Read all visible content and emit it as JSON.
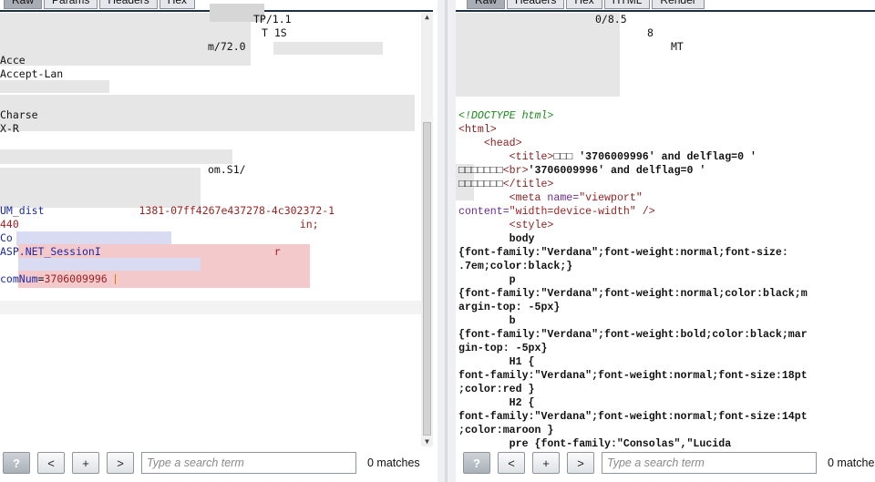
{
  "request": {
    "tabs": [
      "Raw",
      "Params",
      "Headers",
      "Hex"
    ],
    "active_tab": "Raw",
    "lines": {
      "l1_tail": "TP/1.1",
      "l2_tail": "T 1S",
      "l3_tail": "m/72.0",
      "accept": "Acce",
      "accept_lang": "Accept-Lan",
      "charset": "Charse",
      "x": "X-R",
      "ua_tail": "om.S1/",
      "um_key": "UM_dist",
      "um_val": "1381-07ff4267e437278-4c302372-1",
      "l_440": "440",
      "l_440_tail": "in;",
      "co": "Co",
      "aspnet": "ASP.NET_SessionI",
      "aspnet_tail": "r",
      "comnum_key": "comNum",
      "comnum_eq": "=",
      "comnum_val": "3706009996"
    }
  },
  "response": {
    "tabs": [
      "Raw",
      "Headers",
      "Hex",
      "HTML",
      "Render"
    ],
    "active_tab": "Raw",
    "head_lines": {
      "h1": "0/8.5",
      "h2": "8",
      "h3": "MT"
    },
    "html": {
      "doctype": "<!DOCTYPE html>",
      "html_open": "<html>",
      "head_open": "<head>",
      "title_open": "<title>",
      "title_text1": "□□□ '3706009996' and delflag=0 '",
      "title_text2": "□□□□□□□",
      "br": "<br>",
      "title_text3": "'3706009996' and delflag=0 '",
      "title_text4": "□□□□□□□",
      "title_close": "</title>",
      "meta_open": "<meta ",
      "meta_name_attr": "name=",
      "meta_name_val": "\"viewport\"",
      "meta_content_attr": "content=",
      "meta_content_val": "\"width=device-width\"",
      "meta_close": " />",
      "style_open": "<style>",
      "css": [
        "        body",
        "{font-family:\"Verdana\";font-weight:normal;font-size:",
        ".7em;color:black;}",
        "        p",
        "{font-family:\"Verdana\";font-weight:normal;color:black;m",
        "argin-top: -5px}",
        "        b",
        "{font-family:\"Verdana\";font-weight:bold;color:black;mar",
        "gin-top: -5px}",
        "        H1 {",
        "font-family:\"Verdana\";font-weight:normal;font-size:18pt",
        ";color:red }",
        "        H2 {",
        "font-family:\"Verdana\";font-weight:normal;font-size:14pt",
        ";color:maroon }",
        "        pre {font-family:\"Consolas\",\"Lucida"
      ]
    }
  },
  "search": {
    "help_label": "?",
    "prev_label": "<",
    "add_label": "+",
    "next_label": ">",
    "placeholder": "Type a search term",
    "matches": "0 matches"
  }
}
